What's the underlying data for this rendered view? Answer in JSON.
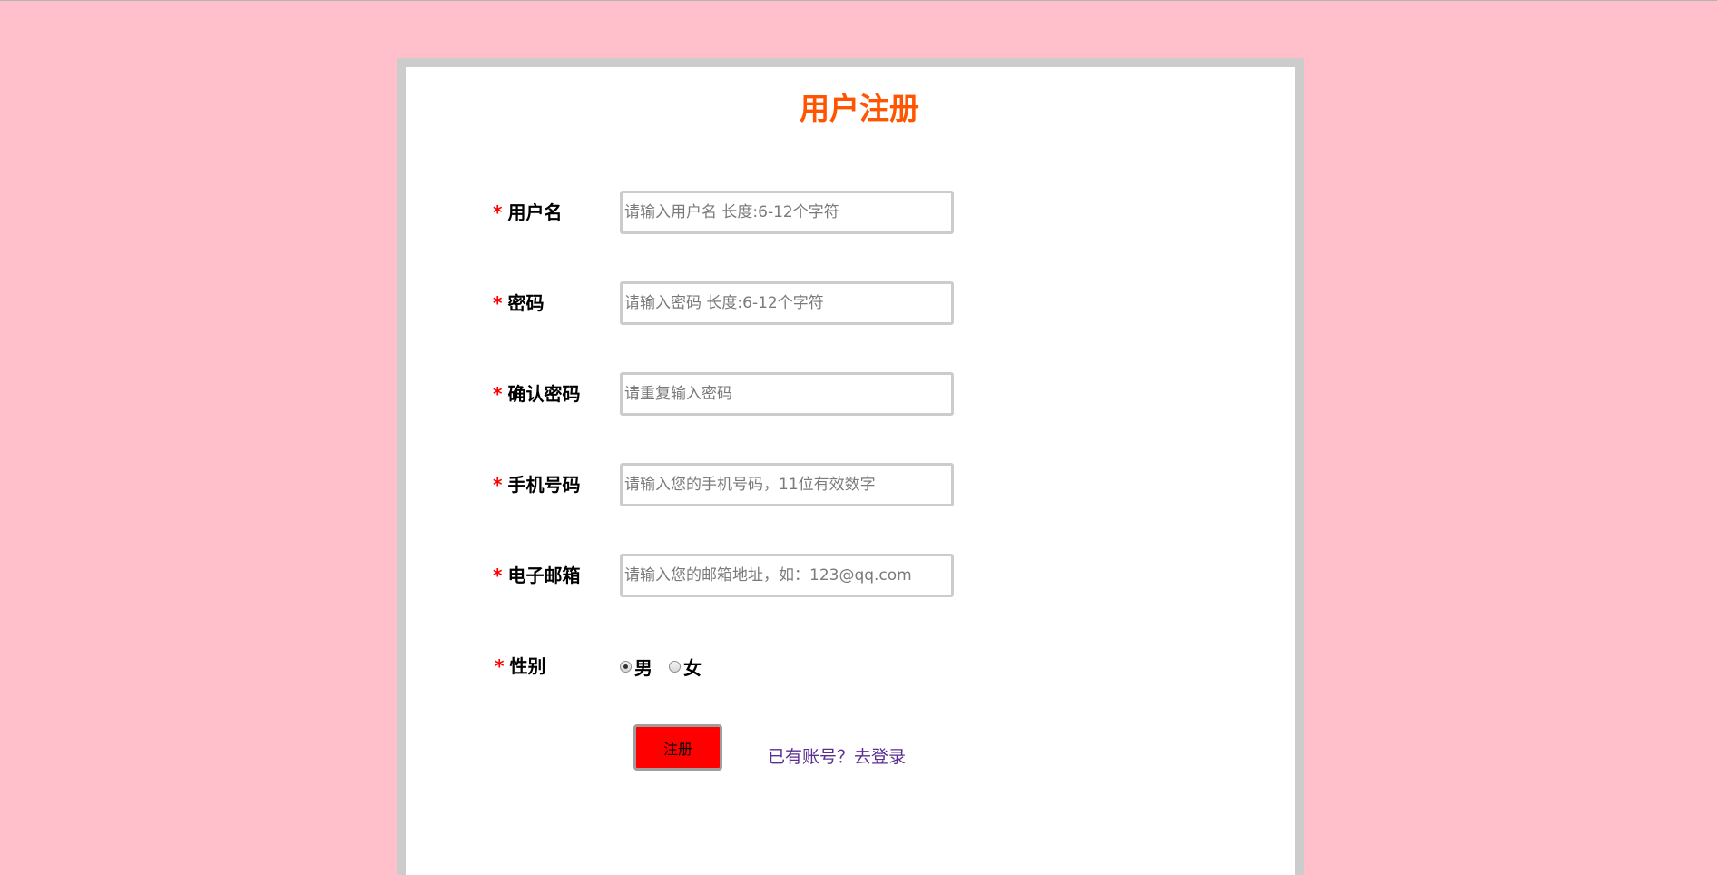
{
  "form": {
    "title": "用户注册",
    "required_mark": "*",
    "fields": [
      {
        "label": "用户名",
        "value": "",
        "placeholder": "请输入用户名 长度:6-12个字符"
      },
      {
        "label": "密码",
        "value": "",
        "placeholder": "请输入密码 长度:6-12个字符"
      },
      {
        "label": "确认密码",
        "value": "",
        "placeholder": "请重复输入密码"
      },
      {
        "label": "手机号码",
        "value": "",
        "placeholder": "请输入您的手机号码，11位有效数字"
      },
      {
        "label": "电子邮箱",
        "value": "",
        "placeholder": "请输入您的邮箱地址，如：123@qq.com"
      }
    ],
    "gender": {
      "label": "性别",
      "options": [
        "男",
        "女"
      ],
      "selected": "男"
    },
    "submit_label": "注册",
    "login_link": "已有账号？去登录"
  },
  "colors": {
    "page_background": "#ffc0cb",
    "title": "#ff5400",
    "required": "#ff0000",
    "submit_button": "#ff0000",
    "link": "#5a2d91"
  }
}
